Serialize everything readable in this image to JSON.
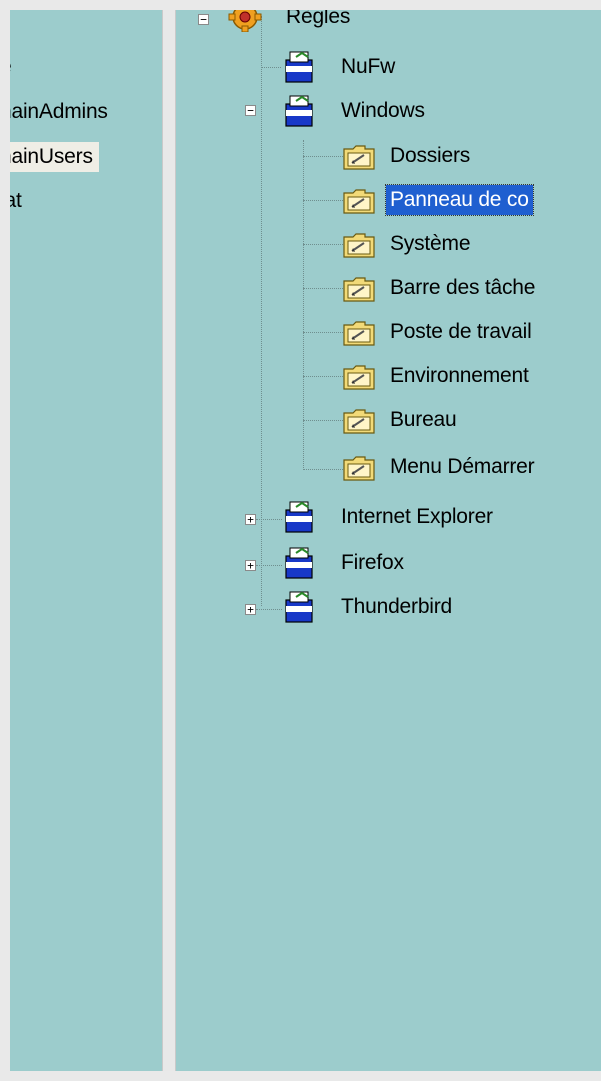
{
  "left_list": {
    "items": [
      {
        "label": "e",
        "selected": false
      },
      {
        "label": "nainAdmins",
        "selected": false
      },
      {
        "label": "nainUsers",
        "selected": true
      },
      {
        "label": "iat",
        "selected": false
      }
    ]
  },
  "tree": {
    "root": {
      "label": "Règles",
      "icon": "gear-icon",
      "expanded": true
    },
    "nodes": [
      {
        "label": "NuFw",
        "icon": "policy-icon"
      },
      {
        "label": "Windows",
        "icon": "policy-icon",
        "expanded": true
      },
      {
        "label": "Dossiers",
        "icon": "folder-icon"
      },
      {
        "label": "Panneau de co",
        "icon": "folder-icon",
        "selected": true
      },
      {
        "label": "Système",
        "icon": "folder-icon"
      },
      {
        "label": "Barre des tâche",
        "icon": "folder-icon"
      },
      {
        "label": "Poste de travail",
        "icon": "folder-icon"
      },
      {
        "label": "Environnement",
        "icon": "folder-icon"
      },
      {
        "label": "Bureau",
        "icon": "folder-icon"
      },
      {
        "label": "Menu Démarrer",
        "icon": "folder-icon"
      },
      {
        "label": "Internet Explorer",
        "icon": "policy-icon",
        "expanded": false
      },
      {
        "label": "Firefox",
        "icon": "policy-icon",
        "expanded": false
      },
      {
        "label": "Thunderbird",
        "icon": "policy-icon",
        "expanded": false
      }
    ],
    "toggles": {
      "expanded": "−",
      "collapsed": "+"
    }
  },
  "colors": {
    "pane_bg": "#9ccccc",
    "selection": "#1f5fd0",
    "frame": "#e9e9e9"
  }
}
